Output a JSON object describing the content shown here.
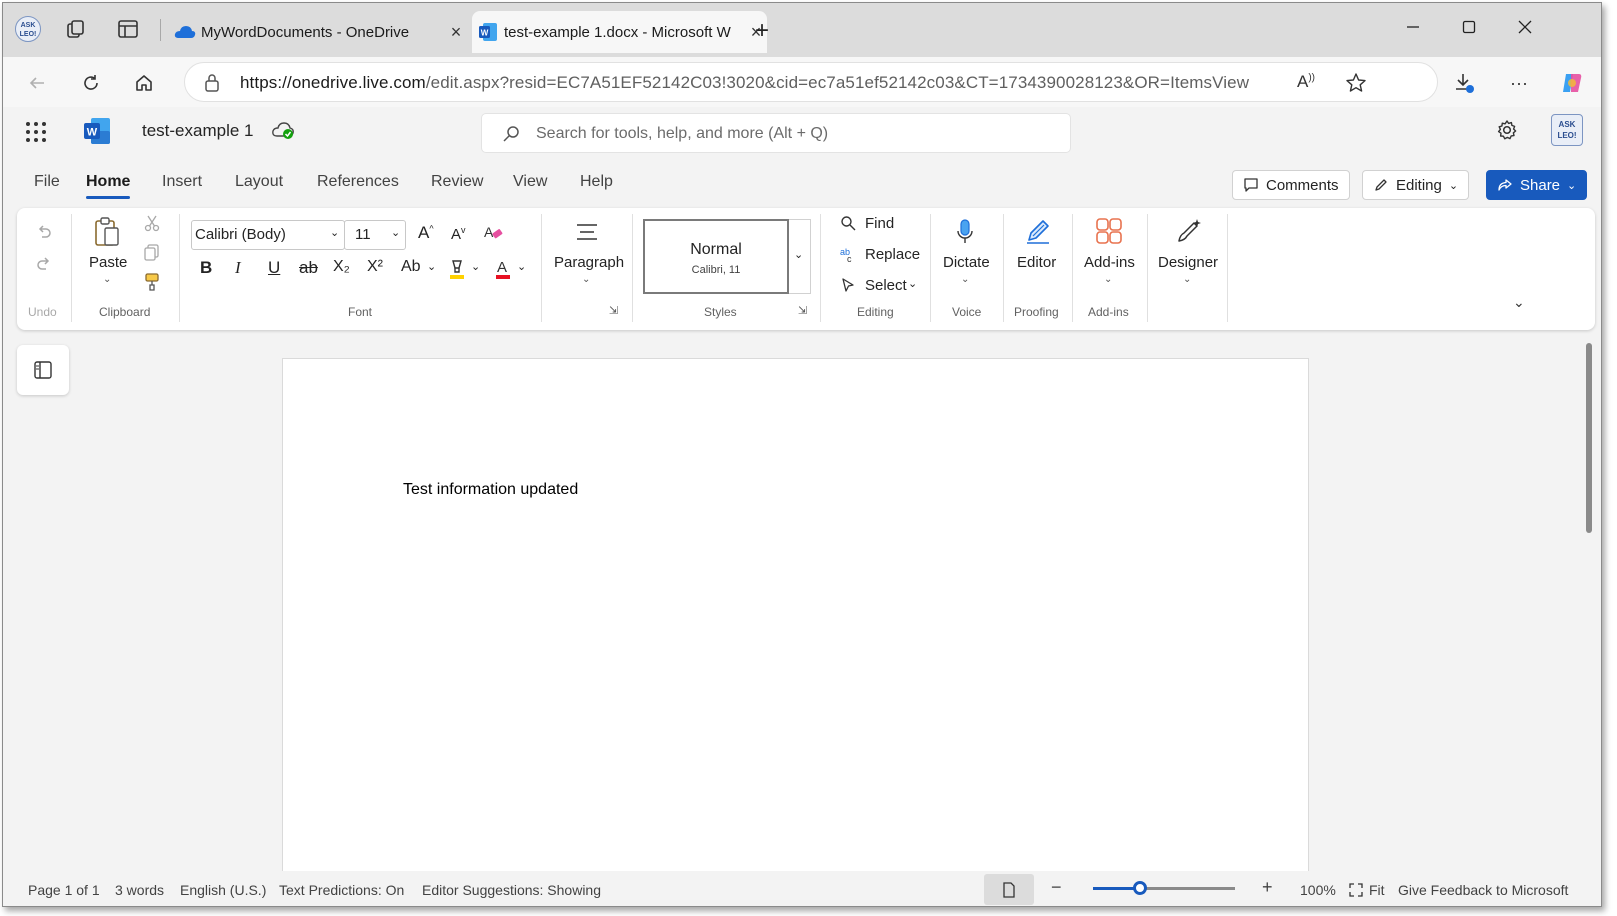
{
  "browser": {
    "tabs": [
      {
        "title": "MyWordDocuments - OneDrive",
        "active": false
      },
      {
        "title": "test-example 1.docx - Microsoft W",
        "active": true
      }
    ],
    "url_host": "https://onedrive.live.com",
    "url_path": "/edit.aspx?resid=EC7A51EF52142C03!3020&cid=ec7a51ef52142c03&CT=1734390028123&OR=ItemsView",
    "profile_badge": "ASK LEO!"
  },
  "word": {
    "doc_title": "test-example 1",
    "search_placeholder": "Search for tools, help, and more (Alt + Q)",
    "user_badge": "ASK LEO!",
    "menu_tabs": [
      "File",
      "Home",
      "Insert",
      "Layout",
      "References",
      "Review",
      "View",
      "Help"
    ],
    "selected_tab": "Home",
    "comments_label": "Comments",
    "editing_label": "Editing",
    "share_label": "Share"
  },
  "ribbon": {
    "undo_group": "Undo",
    "paste_label": "Paste",
    "clipboard_group": "Clipboard",
    "font_name": "Calibri (Body)",
    "font_size": "11",
    "font_group": "Font",
    "paragraph_label": "Paragraph",
    "style_name": "Normal",
    "style_desc": "Calibri, 11",
    "styles_group": "Styles",
    "find_label": "Find",
    "replace_label": "Replace",
    "select_label": "Select",
    "editing_group": "Editing",
    "dictate_label": "Dictate",
    "voice_group": "Voice",
    "editor_label": "Editor",
    "proofing_group": "Proofing",
    "addins_label": "Add-ins",
    "addins_group": "Add-ins",
    "designer_label": "Designer",
    "format_buttons": {
      "bold": "B",
      "italic": "I",
      "underline": "U",
      "strike": "ab",
      "subscript": "X₂",
      "superscript": "X²",
      "case": "Ab"
    }
  },
  "document": {
    "body_text": "Test information updated"
  },
  "statusbar": {
    "page": "Page 1 of 1",
    "words": "3 words",
    "language": "English (U.S.)",
    "predictions": "Text Predictions: On",
    "suggestions": "Editor Suggestions: Showing",
    "zoom": "100%",
    "fit": "Fit",
    "feedback": "Give Feedback to Microsoft",
    "zoom_level": 0.33
  },
  "colors": {
    "word_blue": "#185abd",
    "font_color_bar": "#e81123",
    "highlight_bar": "#ffd100",
    "addins_orange": "#e8724e"
  }
}
